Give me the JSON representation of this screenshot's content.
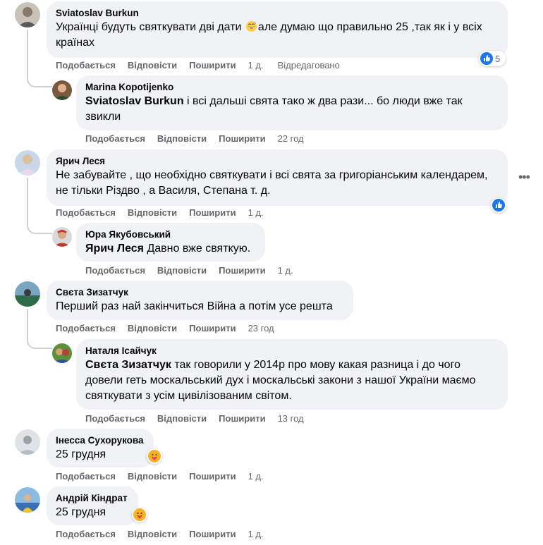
{
  "actions": {
    "like": "Подобається",
    "reply": "Відповісти",
    "share": "Поширити"
  },
  "comments": [
    {
      "author": "Sviatoslav Burkun",
      "text_before": "Українці будуть святкувати дві дати ",
      "emoji": "grinning-sweat-emoji",
      "text_after": "але думаю що правильно 25 ,так як і у всіх країнах",
      "time": "1 д.",
      "edited": "Відредаговано",
      "reaction": {
        "icon": "like-reaction-icon",
        "count": "5",
        "color": "#1877f2"
      },
      "reply": {
        "author": "Marina Kopotijenko",
        "mention": "Sviatoslav Burkun",
        "text": " і всі дальші свята тако ж два рази... бо люди вже так звикли",
        "time": "22 год"
      }
    },
    {
      "author": "Ярич Леся",
      "text": "Не забувайте , що необхідно святкувати і всі свята за григоріанським календарем, не тільки Різдво , а Василя, Степана т. д.",
      "time": "1 д.",
      "reaction": {
        "icon": "like-reaction-icon",
        "color": "#1877f2"
      },
      "more": "•••",
      "reply": {
        "author": "Юра Якубовський",
        "mention": "Ярич Леся",
        "text": " Давно вже святкую.",
        "time": "1 д."
      }
    },
    {
      "author": "Свєта Зизатчук",
      "text": "Перший раз най закінчиться Війна а потім усе решта",
      "time": "23 год",
      "reply": {
        "author": "Наталя Ісайчук",
        "mention": "Свєта Зизатчук",
        "text": " так говорили у 2014р про мову какая разница і до чого довели геть москальський дух і москальські закони з нашої України маємо святкувати з усім цивілізованим світом.",
        "time": "13 год"
      }
    },
    {
      "author": "Інесса Сухорукова",
      "text": "25 грудня",
      "time": "1 д.",
      "reaction": {
        "icon": "care-reaction-icon",
        "color": "#f7b125"
      }
    },
    {
      "author": "Андрій Кіндрат",
      "text": "25 грудня",
      "time": "1 д.",
      "reaction": {
        "icon": "care-reaction-icon",
        "color": "#f7b125"
      }
    }
  ]
}
